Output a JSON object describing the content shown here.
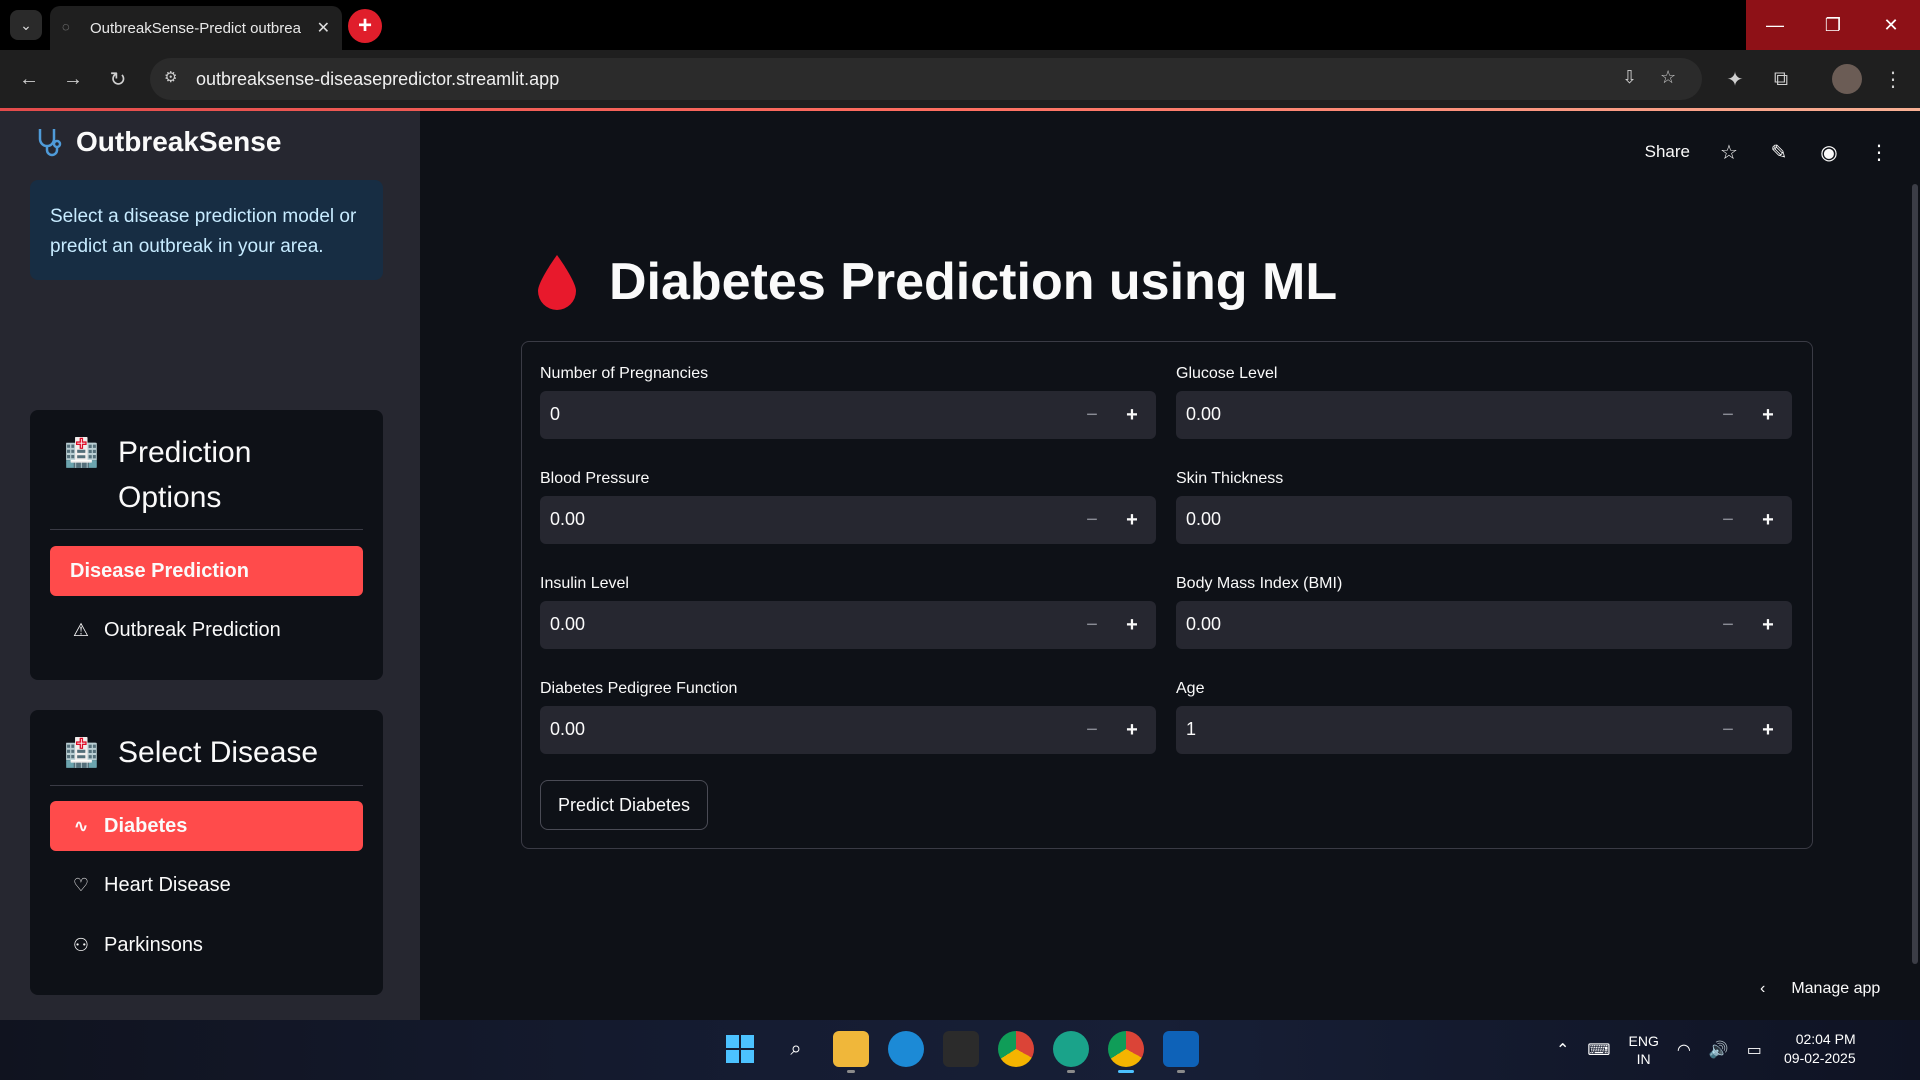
{
  "browser": {
    "tab_title": "OutbreakSense-Predict outbrea",
    "url": "outbreaksense-diseasepredictor.streamlit.app"
  },
  "sidebar": {
    "brand": "OutbreakSense",
    "info": "Select a disease prediction model or predict an outbreak in your area.",
    "prediction_options": {
      "title": "Prediction Options",
      "items": [
        {
          "label": "Disease Prediction",
          "active": true
        },
        {
          "label": "Outbreak Prediction",
          "active": false
        }
      ]
    },
    "select_disease": {
      "title": "Select Disease",
      "items": [
        {
          "label": "Diabetes",
          "active": true
        },
        {
          "label": "Heart Disease",
          "active": false
        },
        {
          "label": "Parkinsons",
          "active": false
        }
      ]
    }
  },
  "header": {
    "share": "Share"
  },
  "main": {
    "title": "Diabetes Prediction using ML",
    "fields": [
      {
        "label": "Number of Pregnancies",
        "value": "0"
      },
      {
        "label": "Glucose Level",
        "value": "0.00"
      },
      {
        "label": "Blood Pressure",
        "value": "0.00"
      },
      {
        "label": "Skin Thickness",
        "value": "0.00"
      },
      {
        "label": "Insulin Level",
        "value": "0.00"
      },
      {
        "label": "Body Mass Index (BMI)",
        "value": "0.00"
      },
      {
        "label": "Diabetes Pedigree Function",
        "value": "0.00"
      },
      {
        "label": "Age",
        "value": "1"
      }
    ],
    "submit": "Predict Diabetes",
    "manage_app": "Manage app"
  },
  "taskbar": {
    "lang": "ENG",
    "region": "IN",
    "time": "02:04 PM",
    "date": "09-02-2025"
  },
  "colors": {
    "accent": "#ff4b4b",
    "sidebar_bg": "#262730",
    "main_bg": "#0e1117",
    "info_bg": "#172d43"
  }
}
